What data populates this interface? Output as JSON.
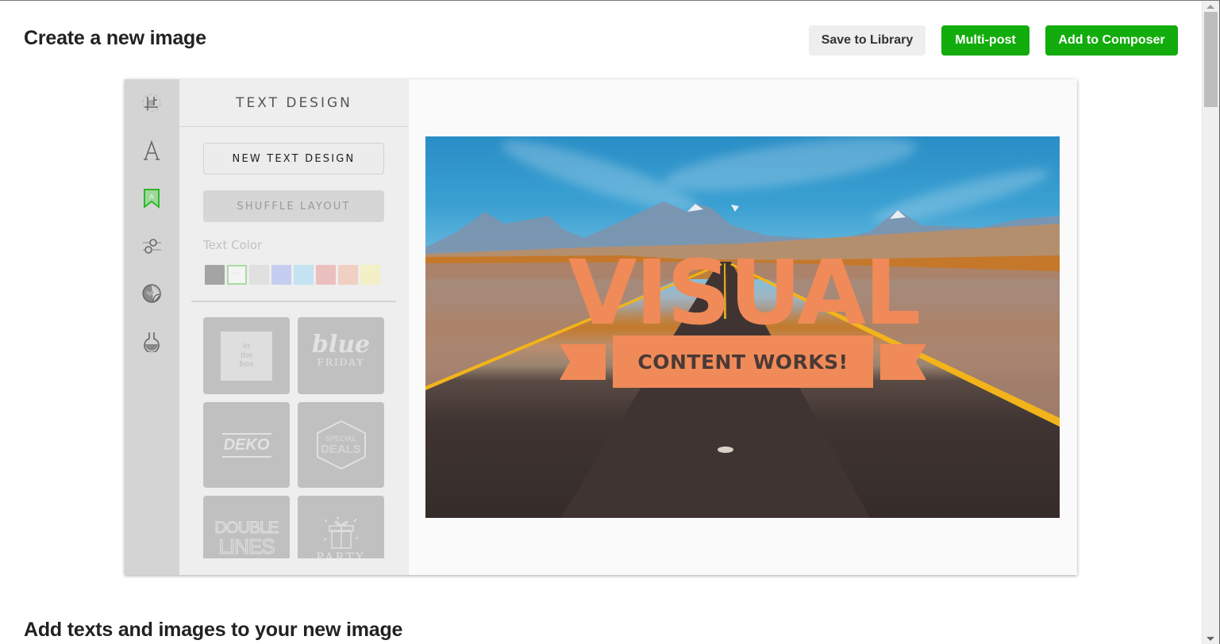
{
  "page": {
    "title": "Create a new image",
    "section_title": "Add texts and images to your new image"
  },
  "toolbar": {
    "save_label": "Save to Library",
    "multipost_label": "Multi-post",
    "composer_label": "Add to Composer"
  },
  "colors": {
    "accent_green": "#12ac0c",
    "active_tool": "#2db82a",
    "overlay_orange": "#f08a58"
  },
  "tools": [
    {
      "name": "crop-icon",
      "active": false
    },
    {
      "name": "font-icon",
      "active": false
    },
    {
      "name": "text-design-icon",
      "active": true
    },
    {
      "name": "adjust-icon",
      "active": false
    },
    {
      "name": "sticker-icon",
      "active": false
    },
    {
      "name": "filter-icon",
      "active": false
    }
  ],
  "panel": {
    "title": "TEXT DESIGN",
    "new_design_label": "NEW TEXT DESIGN",
    "shuffle_label": "SHUFFLE LAYOUT",
    "text_color_label": "Text Color",
    "swatches": [
      "#a4a4a4",
      "#f4f4f4",
      "#e0e0e0",
      "#c5cdf0",
      "#c4e2f2",
      "#ecbfbf",
      "#efd0c2",
      "#f3efc6"
    ],
    "selected_swatch": 1,
    "templates": [
      {
        "id": "in-the-box",
        "lines": [
          "in",
          "the",
          "box"
        ]
      },
      {
        "id": "blue-friday",
        "lines": [
          "blue",
          "FRIDAY"
        ]
      },
      {
        "id": "deko",
        "lines": [
          "DEKO"
        ]
      },
      {
        "id": "special-deals",
        "lines": [
          "SPECIAL",
          "DEALS"
        ]
      },
      {
        "id": "double-lines",
        "lines": [
          "DOUBLE",
          "LINES"
        ]
      },
      {
        "id": "party",
        "lines": [
          "PARTY"
        ]
      }
    ]
  },
  "canvas": {
    "headline": "VISUAL",
    "banner_text": "CONTENT WORKS!"
  }
}
